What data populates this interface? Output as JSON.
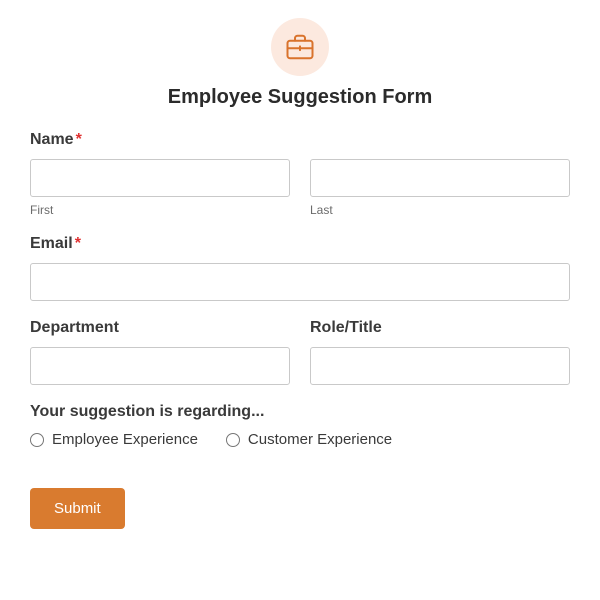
{
  "form": {
    "title": "Employee Suggestion Form",
    "icon": "briefcase-icon",
    "labels": {
      "name": "Name",
      "first": "First",
      "last": "Last",
      "email": "Email",
      "department": "Department",
      "role": "Role/Title",
      "suggestion": "Your suggestion is regarding...",
      "required": "*"
    },
    "radio": {
      "opt1": "Employee Experience",
      "opt2": "Customer Experience"
    },
    "submit": "Submit"
  }
}
